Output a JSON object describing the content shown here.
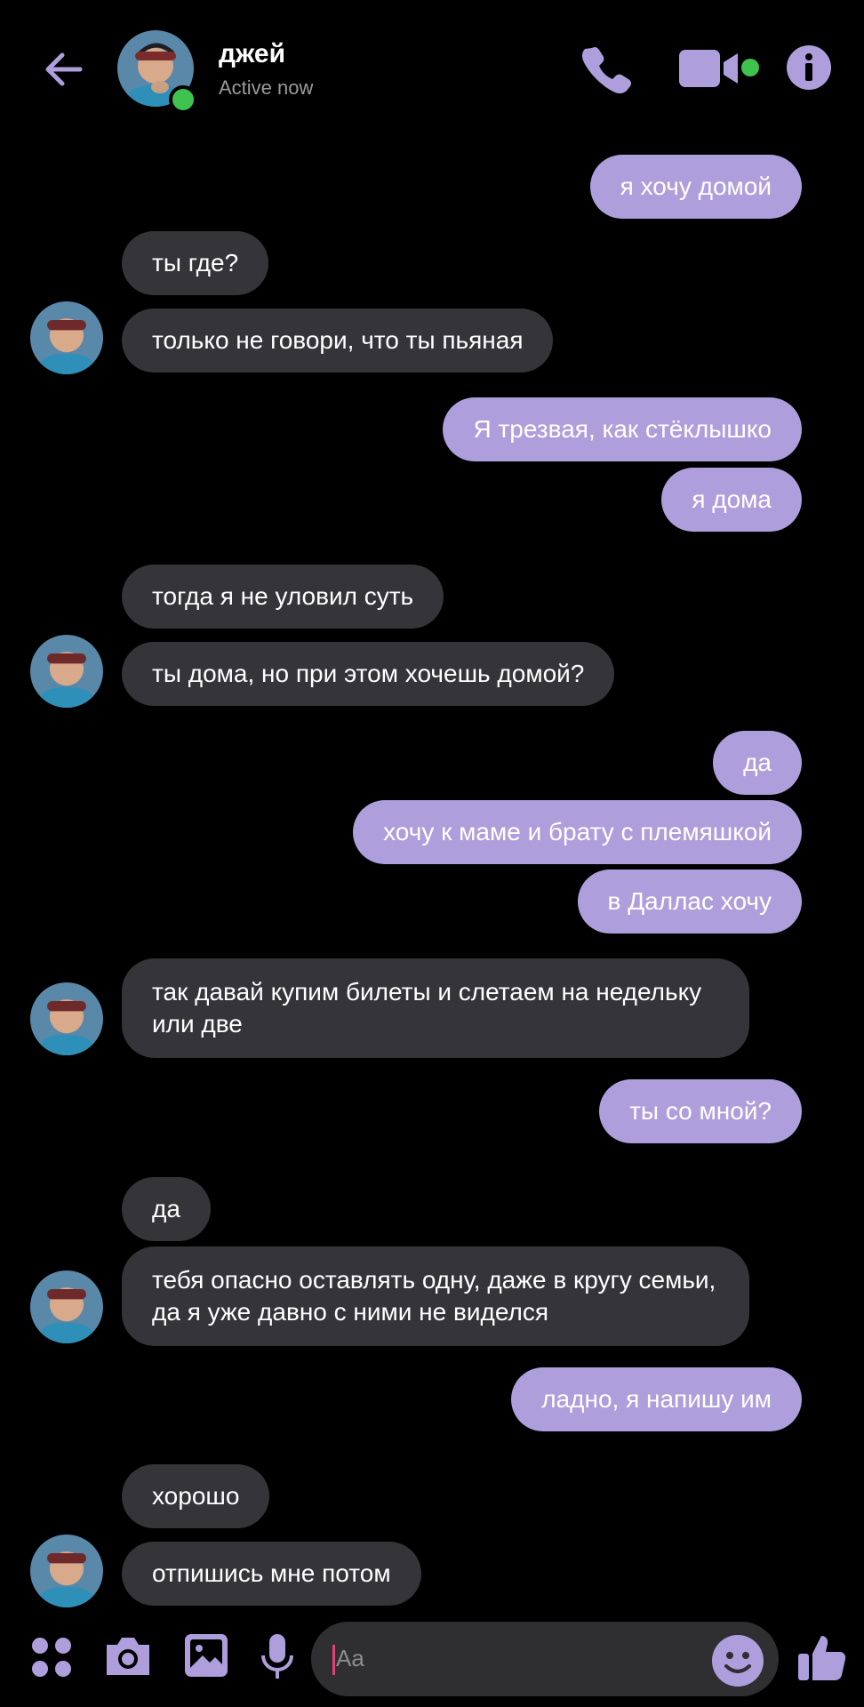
{
  "header": {
    "back_icon": "arrow-left-icon",
    "contact_name": "джей",
    "status": "Active now",
    "call_icon": "phone-icon",
    "video_icon": "video-camera-icon",
    "info_icon": "info-icon",
    "accent_color": "#ae9fdc",
    "online_color": "#3fc34e"
  },
  "messages": [
    {
      "side": "out",
      "text": "я хочу домой"
    },
    {
      "side": "in",
      "text": "ты где?"
    },
    {
      "side": "in",
      "text": "только не говори, что ты пьяная"
    },
    {
      "side": "out",
      "text": "Я трезвая, как стёклышко"
    },
    {
      "side": "out",
      "text": "я дома"
    },
    {
      "side": "in",
      "text": "тогда я не уловил суть"
    },
    {
      "side": "in",
      "text": "ты дома, но при этом хочешь домой?"
    },
    {
      "side": "out",
      "text": "да"
    },
    {
      "side": "out",
      "text": "хочу к маме и брату с племяшкой"
    },
    {
      "side": "out",
      "text": "в Даллас хочу"
    },
    {
      "side": "in",
      "text": "так давай купим билеты и слетаем на недельку или две"
    },
    {
      "side": "out",
      "text": "ты со мной?"
    },
    {
      "side": "in",
      "text": "да"
    },
    {
      "side": "in",
      "text": "тебя опасно оставлять одну,  даже в кругу семьи, да я уже давно с ними не виделся"
    },
    {
      "side": "out",
      "text": "ладно, я напишу им"
    },
    {
      "side": "in",
      "text": "хорошо"
    },
    {
      "side": "in",
      "text": "отпишись мне потом"
    }
  ],
  "composer": {
    "placeholder": "Aa",
    "icons": [
      "apps-icon",
      "camera-icon",
      "gallery-icon",
      "microphone-icon",
      "emoji-icon",
      "thumbs-up-icon"
    ]
  },
  "colors": {
    "outgoing_bubble": "#ae9fdc",
    "incoming_bubble": "#353438",
    "background": "#000000"
  }
}
